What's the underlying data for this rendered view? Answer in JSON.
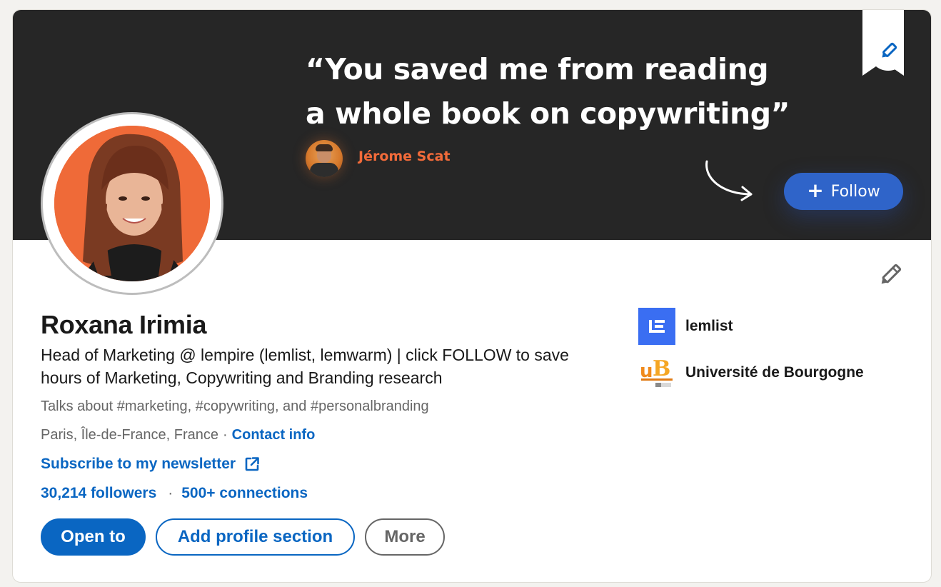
{
  "banner": {
    "quote_line1": "“You saved me from reading",
    "quote_line2": "a whole book on copywriting”",
    "quote_author": "Jérome Scat",
    "follow_label": "Follow",
    "background_color": "#262626",
    "accent_color": "#f26b3a",
    "follow_color": "#2f64c9"
  },
  "profile": {
    "name": "Roxana Irimia",
    "headline": "Head of Marketing @ lempire (lemlist, lemwarm) | click FOLLOW to save hours of Marketing, Copywriting and Branding research",
    "talks_about": "Talks about #marketing, #copywriting, and #personalbranding",
    "location": "Paris, Île-de-France, France",
    "location_separator": "·",
    "contact_info": "Contact info",
    "newsletter": "Subscribe to my newsletter",
    "followers": "30,214 followers",
    "stats_separator": "·",
    "connections": "500+ connections"
  },
  "actions": {
    "open_to": "Open to",
    "add_section": "Add profile section",
    "more": "More"
  },
  "organizations": [
    {
      "name": "lemlist",
      "icon": "lemlist-logo"
    },
    {
      "name": "Université de Bourgogne",
      "icon": "universite-bourgogne-logo"
    }
  ],
  "colors": {
    "link": "#0a66c2",
    "primary": "#0a66c2",
    "avatar_background": "#ef6a38",
    "page_background": "#f3f2ef"
  },
  "icons": {
    "banner_edit": "pencil-icon",
    "intro_edit": "pencil-icon",
    "newsletter": "external-link-icon",
    "follow": "plus-icon"
  }
}
